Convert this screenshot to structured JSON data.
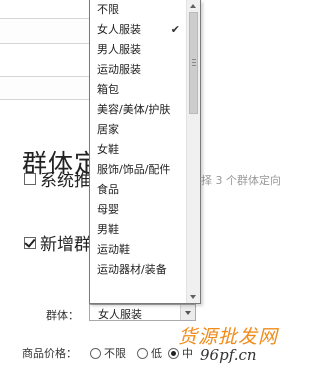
{
  "section": {
    "title": "群体定",
    "note": "择 3 个群体定向"
  },
  "options": {
    "system_label": "系统推",
    "new_label": "新增群"
  },
  "group_row": {
    "label": "群体：",
    "selected": "女人服装"
  },
  "price_row": {
    "label": "商品价格：",
    "options": [
      "不限",
      "低",
      "中"
    ],
    "selected_index": 2
  },
  "dropdown": {
    "items": [
      "不限",
      "女人服装",
      "男人服装",
      "运动服装",
      "箱包",
      "美容/美体/护肤",
      "居家",
      "女鞋",
      "服饰/饰品/配件",
      "食品",
      "母婴",
      "男鞋",
      "运动鞋",
      "运动器材/装备"
    ],
    "selected_index": 1,
    "scrollbar_position": 0.0
  },
  "watermark": {
    "cn": "货源批发网",
    "url": "96pf.cn"
  },
  "icons": {
    "check": "check-icon",
    "scroll_up": "scroll-up-arrow-icon",
    "scroll_down": "scroll-down-arrow-icon",
    "select_arrow": "chevron-down-icon"
  }
}
